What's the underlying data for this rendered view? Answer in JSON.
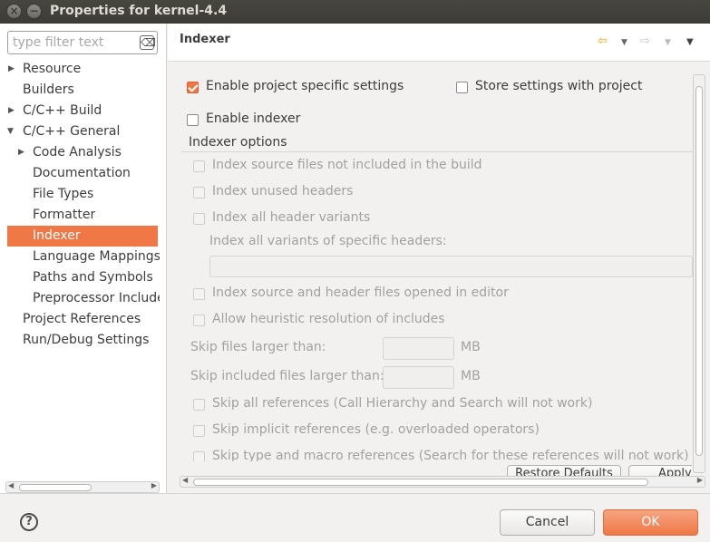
{
  "window": {
    "title": "Properties for kernel-4.4",
    "close_glyph": "×",
    "minimize_glyph": "−"
  },
  "filter": {
    "placeholder": "type filter text",
    "value": ""
  },
  "tree": [
    {
      "label": "Resource"
    },
    {
      "label": "Builders"
    },
    {
      "label": "C/C++ Build"
    },
    {
      "label": "C/C++ General"
    },
    {
      "label": "Code Analysis"
    },
    {
      "label": "Documentation"
    },
    {
      "label": "File Types"
    },
    {
      "label": "Formatter"
    },
    {
      "label": "Indexer"
    },
    {
      "label": "Language Mappings"
    },
    {
      "label": "Paths and Symbols"
    },
    {
      "label": "Preprocessor Include"
    },
    {
      "label": "Project References"
    },
    {
      "label": "Run/Debug Settings"
    }
  ],
  "selected_item": "Indexer",
  "page": {
    "title": "Indexer",
    "enable_project_specific": {
      "label": "Enable project specific settings",
      "checked": true
    },
    "store_with_project": {
      "label": "Store settings with project",
      "checked": false
    },
    "enable_indexer": {
      "label": "Enable indexer",
      "checked": false
    },
    "group_label": "Indexer options",
    "options": [
      {
        "label": "Index source files not included in the build"
      },
      {
        "label": "Index unused headers"
      },
      {
        "label": "Index all header variants"
      },
      {
        "label": "Index source and header files opened in editor"
      },
      {
        "label": "Allow heuristic resolution of includes"
      },
      {
        "label": "Skip all references (Call Hierarchy and Search will not work)"
      },
      {
        "label": "Skip implicit references (e.g. overloaded operators)"
      },
      {
        "label": "Skip type and macro references (Search for these references will not work)"
      }
    ],
    "specific_headers_label": "Index all variants of specific headers:",
    "skip_files_label": "Skip files larger than:",
    "skip_included_label": "Skip included files larger than:",
    "unit_mb": "MB",
    "restore_defaults": "Restore Defaults",
    "apply": "Apply"
  },
  "buttons": {
    "cancel": "Cancel",
    "ok": "OK",
    "help": "?"
  },
  "colors": {
    "accent": "#f07746",
    "title_bar": "#3c3b37"
  }
}
